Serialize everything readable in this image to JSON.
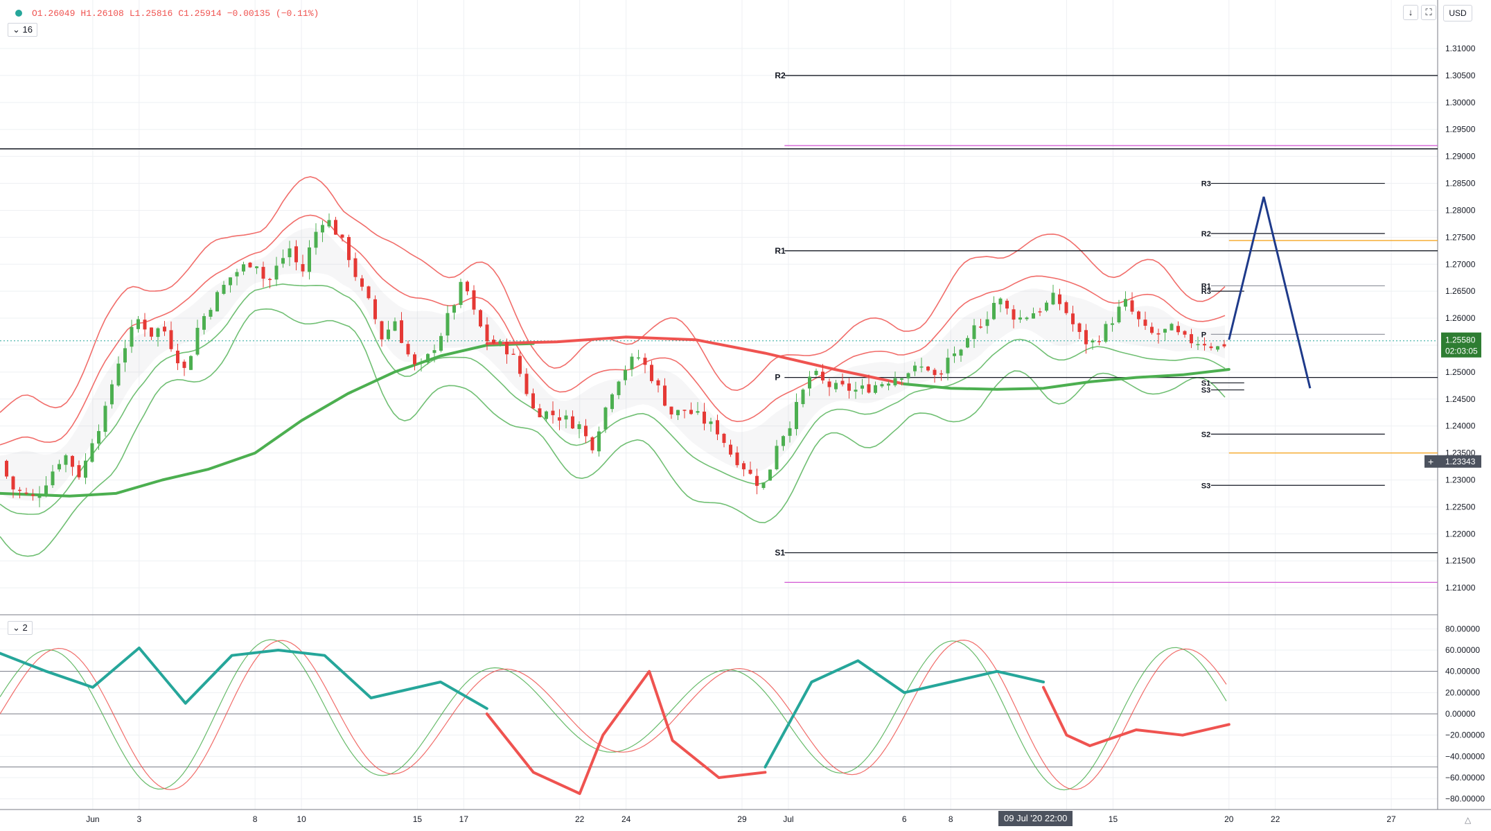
{
  "header": {
    "ohlc": [
      "O1.26049",
      "H1.26108",
      "L1.25816",
      "C1.25914",
      "−0.00135 (−0.11%)"
    ],
    "main_pane_toggle": "16",
    "osc_pane_toggle": "2",
    "currency": "USD",
    "download_icon": "download-icon",
    "fullscreen_icon": "fullscreen-icon",
    "crosshair_time": "09 Jul '20   22:00",
    "last_price_label": "1.25580",
    "countdown_label": "02:03:05",
    "crosshair_price_label": "1.23343"
  },
  "colors": {
    "bull": "#26a69a",
    "bull_candle": "#4caf50",
    "bear": "#ef5350",
    "bear_candle": "#e53935",
    "ma_up": "#4caf50",
    "ma_down": "#ef5350",
    "pivot_line": "#131722",
    "magenta_level": "#d561d6",
    "orange_level": "#f5a623",
    "projection": "#1e3a8a",
    "last_price_bg": "#2e7d32"
  },
  "chart_data": [
    {
      "type": "candlestick",
      "instrument_quote": "USD",
      "y_axis": {
        "range": [
          1.205,
          1.319
        ],
        "ticks": [
          "1.31000",
          "1.30500",
          "1.30000",
          "1.29500",
          "1.29000",
          "1.28500",
          "1.28000",
          "1.27500",
          "1.27000",
          "1.26500",
          "1.26000",
          "1.25500",
          "1.25000",
          "1.24500",
          "1.24000",
          "1.23500",
          "1.23000",
          "1.22500",
          "1.22000",
          "1.21500",
          "1.21000"
        ]
      },
      "x_axis": {
        "range": [
          "2020-05-28",
          "2020-07-29"
        ],
        "ticks": [
          {
            "date": "2020-06-01",
            "label": "Jun"
          },
          {
            "date": "2020-06-03",
            "label": "3"
          },
          {
            "date": "2020-06-08",
            "label": "8"
          },
          {
            "date": "2020-06-10",
            "label": "10"
          },
          {
            "date": "2020-06-15",
            "label": "15"
          },
          {
            "date": "2020-06-17",
            "label": "17"
          },
          {
            "date": "2020-06-22",
            "label": "22"
          },
          {
            "date": "2020-06-24",
            "label": "24"
          },
          {
            "date": "2020-06-29",
            "label": "29"
          },
          {
            "date": "2020-07-01",
            "label": "Jul"
          },
          {
            "date": "2020-07-06",
            "label": "6"
          },
          {
            "date": "2020-07-08",
            "label": "8"
          },
          {
            "date": "2020-07-13",
            "label": "13"
          },
          {
            "date": "2020-07-15",
            "label": "15"
          },
          {
            "date": "2020-07-20",
            "label": "20"
          },
          {
            "date": "2020-07-22",
            "label": "22"
          },
          {
            "date": "2020-07-27",
            "label": "27"
          }
        ]
      },
      "close_path": [
        {
          "x": "2020-05-28",
          "y": 1.2335
        },
        {
          "x": "2020-05-28 12:00",
          "y": 1.2285
        },
        {
          "x": "2020-05-29",
          "y": 1.2275
        },
        {
          "x": "2020-05-29 12:00",
          "y": 1.2265
        },
        {
          "x": "2020-05-30 18:00",
          "y": 1.235
        },
        {
          "x": "2020-05-31 12:00",
          "y": 1.2305
        },
        {
          "x": "2020-06-01",
          "y": 1.238
        },
        {
          "x": "2020-06-01 12:00",
          "y": 1.242
        },
        {
          "x": "2020-06-02",
          "y": 1.251
        },
        {
          "x": "2020-06-02 12:00",
          "y": 1.256
        },
        {
          "x": "2020-06-03",
          "y": 1.26
        },
        {
          "x": "2020-06-03 12:00",
          "y": 1.257
        },
        {
          "x": "2020-06-04",
          "y": 1.2585
        },
        {
          "x": "2020-06-04 12:00",
          "y": 1.254
        },
        {
          "x": "2020-06-05",
          "y": 1.25
        },
        {
          "x": "2020-06-05 12:00",
          "y": 1.258
        },
        {
          "x": "2020-06-06",
          "y": 1.262
        },
        {
          "x": "2020-06-07",
          "y": 1.268
        },
        {
          "x": "2020-06-08",
          "y": 1.271
        },
        {
          "x": "2020-06-08 12:00",
          "y": 1.266
        },
        {
          "x": "2020-06-09",
          "y": 1.27
        },
        {
          "x": "2020-06-09 12:00",
          "y": 1.273
        },
        {
          "x": "2020-06-10",
          "y": 1.268
        },
        {
          "x": "2020-06-10 12:00",
          "y": 1.275
        },
        {
          "x": "2020-06-11",
          "y": 1.279
        },
        {
          "x": "2020-06-11 12:00",
          "y": 1.276
        },
        {
          "x": "2020-06-12",
          "y": 1.272
        },
        {
          "x": "2020-06-12 12:00",
          "y": 1.266
        },
        {
          "x": "2020-06-13",
          "y": 1.262
        },
        {
          "x": "2020-06-13 12:00",
          "y": 1.256
        },
        {
          "x": "2020-06-14",
          "y": 1.26
        },
        {
          "x": "2020-06-14 12:00",
          "y": 1.254
        },
        {
          "x": "2020-06-15",
          "y": 1.25
        },
        {
          "x": "2020-06-15 12:00",
          "y": 1.253
        },
        {
          "x": "2020-06-16",
          "y": 1.257
        },
        {
          "x": "2020-06-16 12:00",
          "y": 1.262
        },
        {
          "x": "2020-06-17",
          "y": 1.267
        },
        {
          "x": "2020-06-17 12:00",
          "y": 1.26
        },
        {
          "x": "2020-06-18",
          "y": 1.256
        },
        {
          "x": "2020-06-18 12:00",
          "y": 1.255
        },
        {
          "x": "2020-06-19",
          "y": 1.254
        },
        {
          "x": "2020-06-19 12:00",
          "y": 1.249
        },
        {
          "x": "2020-06-20",
          "y": 1.243
        },
        {
          "x": "2020-06-21",
          "y": 1.242
        },
        {
          "x": "2020-06-22",
          "y": 1.24
        },
        {
          "x": "2020-06-22 12:00",
          "y": 1.236
        },
        {
          "x": "2020-06-23",
          "y": 1.242
        },
        {
          "x": "2020-06-23 12:00",
          "y": 1.248
        },
        {
          "x": "2020-06-24",
          "y": 1.251
        },
        {
          "x": "2020-06-24 12:00",
          "y": 1.253
        },
        {
          "x": "2020-06-25",
          "y": 1.25
        },
        {
          "x": "2020-06-25 12:00",
          "y": 1.246
        },
        {
          "x": "2020-06-26",
          "y": 1.242
        },
        {
          "x": "2020-06-26 12:00",
          "y": 1.243
        },
        {
          "x": "2020-06-27",
          "y": 1.242
        },
        {
          "x": "2020-06-28",
          "y": 1.239
        },
        {
          "x": "2020-06-28 12:00",
          "y": 1.235
        },
        {
          "x": "2020-06-29",
          "y": 1.233
        },
        {
          "x": "2020-06-29 12:00",
          "y": 1.23
        },
        {
          "x": "2020-06-30",
          "y": 1.229
        },
        {
          "x": "2020-06-30 12:00",
          "y": 1.237
        },
        {
          "x": "2020-07-01",
          "y": 1.24
        },
        {
          "x": "2020-07-01 12:00",
          "y": 1.245
        },
        {
          "x": "2020-07-02",
          "y": 1.25
        },
        {
          "x": "2020-07-02 12:00",
          "y": 1.248
        },
        {
          "x": "2020-07-03",
          "y": 1.247
        },
        {
          "x": "2020-07-03 12:00",
          "y": 1.247
        },
        {
          "x": "2020-07-04",
          "y": 1.2465
        },
        {
          "x": "2020-07-05",
          "y": 1.248
        },
        {
          "x": "2020-07-06",
          "y": 1.25
        },
        {
          "x": "2020-07-06 12:00",
          "y": 1.2505
        },
        {
          "x": "2020-07-07",
          "y": 1.251
        },
        {
          "x": "2020-07-07 12:00",
          "y": 1.248
        },
        {
          "x": "2020-07-08",
          "y": 1.254
        },
        {
          "x": "2020-07-08 12:00",
          "y": 1.253
        },
        {
          "x": "2020-07-09",
          "y": 1.258
        },
        {
          "x": "2020-07-09 12:00",
          "y": 1.26
        },
        {
          "x": "2020-07-10",
          "y": 1.264
        },
        {
          "x": "2020-07-10 12:00",
          "y": 1.261
        },
        {
          "x": "2020-07-11",
          "y": 1.26
        },
        {
          "x": "2020-07-12",
          "y": 1.262
        },
        {
          "x": "2020-07-12 12:00",
          "y": 1.264
        },
        {
          "x": "2020-07-13",
          "y": 1.261
        },
        {
          "x": "2020-07-13 12:00",
          "y": 1.257
        },
        {
          "x": "2020-07-14",
          "y": 1.255
        },
        {
          "x": "2020-07-14 12:00",
          "y": 1.257
        },
        {
          "x": "2020-07-15",
          "y": 1.26
        },
        {
          "x": "2020-07-15 12:00",
          "y": 1.263
        },
        {
          "x": "2020-07-16",
          "y": 1.26
        },
        {
          "x": "2020-07-16 12:00",
          "y": 1.257
        },
        {
          "x": "2020-07-17",
          "y": 1.257
        },
        {
          "x": "2020-07-17 12:00",
          "y": 1.258
        },
        {
          "x": "2020-07-18",
          "y": 1.256
        },
        {
          "x": "2020-07-19",
          "y": 1.2555
        },
        {
          "x": "2020-07-19 12:00",
          "y": 1.2545
        },
        {
          "x": "2020-07-20",
          "y": 1.2558
        }
      ],
      "moving_averages": [
        {
          "color": "ma_up",
          "points": [
            {
              "x": "2020-05-28",
              "y": 1.2275
            },
            {
              "x": "2020-05-31",
              "y": 1.227
            },
            {
              "x": "2020-06-02",
              "y": 1.2275
            },
            {
              "x": "2020-06-04",
              "y": 1.23
            },
            {
              "x": "2020-06-06",
              "y": 1.232
            },
            {
              "x": "2020-06-08",
              "y": 1.235
            },
            {
              "x": "2020-06-10",
              "y": 1.241
            },
            {
              "x": "2020-06-12",
              "y": 1.246
            },
            {
              "x": "2020-06-14",
              "y": 1.25
            },
            {
              "x": "2020-06-16",
              "y": 1.253
            },
            {
              "x": "2020-06-18",
              "y": 1.255
            },
            {
              "x": "2020-06-20",
              "y": 1.2553
            }
          ]
        },
        {
          "color": "ma_down",
          "points": [
            {
              "x": "2020-06-18",
              "y": 1.2553
            },
            {
              "x": "2020-06-21",
              "y": 1.2556
            },
            {
              "x": "2020-06-24",
              "y": 1.2565
            },
            {
              "x": "2020-06-27",
              "y": 1.256
            },
            {
              "x": "2020-06-30",
              "y": 1.2535
            },
            {
              "x": "2020-07-03",
              "y": 1.2505
            },
            {
              "x": "2020-07-06",
              "y": 1.2478
            }
          ]
        },
        {
          "color": "ma_up",
          "points": [
            {
              "x": "2020-07-06",
              "y": 1.2478
            },
            {
              "x": "2020-07-08",
              "y": 1.247
            },
            {
              "x": "2020-07-10",
              "y": 1.2468
            },
            {
              "x": "2020-07-12",
              "y": 1.247
            },
            {
              "x": "2020-07-14",
              "y": 1.2482
            },
            {
              "x": "2020-07-16",
              "y": 1.249
            },
            {
              "x": "2020-07-18",
              "y": 1.2495
            },
            {
              "x": "2020-07-20",
              "y": 1.2505
            }
          ]
        }
      ],
      "pivot_levels_june": [
        {
          "label": "R2",
          "value": 1.305
        },
        {
          "label": "R1",
          "value": 1.2725
        },
        {
          "label": "P",
          "value": 1.249
        },
        {
          "label": "S1",
          "value": 1.2165
        }
      ],
      "pivot_levels_week": [
        {
          "label": "R3",
          "value": 1.285
        },
        {
          "label": "R2",
          "value": 1.2757
        },
        {
          "label": "R1",
          "value": 1.266
        },
        {
          "label": "R3",
          "value": 1.265
        },
        {
          "label": "P",
          "value": 1.257
        },
        {
          "label": "S1",
          "value": 1.248
        },
        {
          "label": "S3",
          "value": 1.2467
        },
        {
          "label": "S2",
          "value": 1.2385
        },
        {
          "label": "S3",
          "value": 1.229
        }
      ],
      "horizontal_levels": [
        {
          "value": 1.2914,
          "color": "pivot_line"
        },
        {
          "value": 1.292,
          "color": "magenta_level"
        },
        {
          "value": 1.211,
          "color": "magenta_level"
        },
        {
          "value": 1.2744,
          "color": "orange_level"
        },
        {
          "value": 1.235,
          "color": "orange_level"
        },
        {
          "value": 1.2558,
          "color": "bull"
        }
      ],
      "projection": [
        {
          "x": "2020-07-20",
          "y": 1.256
        },
        {
          "x": "2020-07-21 12:00",
          "y": 1.2825
        },
        {
          "x": "2020-07-23 12:00",
          "y": 1.247
        }
      ]
    },
    {
      "type": "line",
      "y_axis": {
        "range": [
          -90,
          90
        ],
        "ticks": [
          "80.00000",
          "60.00000",
          "40.00000",
          "20.00000",
          "0.00000",
          "−20.00000",
          "−40.00000",
          "−60.00000",
          "−80.00000"
        ],
        "ref_lines": [
          40,
          0,
          -50
        ]
      },
      "series": [
        {
          "color": "bull",
          "points": [
            {
              "x": "2020-05-28",
              "y": 57
            },
            {
              "x": "2020-05-30",
              "y": 40
            },
            {
              "x": "2020-06-01",
              "y": 25
            },
            {
              "x": "2020-06-03",
              "y": 62
            },
            {
              "x": "2020-06-05",
              "y": 10
            },
            {
              "x": "2020-06-07",
              "y": 55
            },
            {
              "x": "2020-06-09",
              "y": 60
            },
            {
              "x": "2020-06-11",
              "y": 55
            },
            {
              "x": "2020-06-13",
              "y": 15
            },
            {
              "x": "2020-06-16",
              "y": 30
            },
            {
              "x": "2020-06-18",
              "y": 5
            }
          ]
        },
        {
          "color": "bear",
          "points": [
            {
              "x": "2020-06-18",
              "y": 0
            },
            {
              "x": "2020-06-20",
              "y": -55
            },
            {
              "x": "2020-06-22",
              "y": -75
            },
            {
              "x": "2020-06-23",
              "y": -20
            },
            {
              "x": "2020-06-25",
              "y": 40
            },
            {
              "x": "2020-06-26",
              "y": -25
            },
            {
              "x": "2020-06-28",
              "y": -60
            },
            {
              "x": "2020-06-30",
              "y": -55
            }
          ]
        },
        {
          "color": "bull",
          "points": [
            {
              "x": "2020-06-30",
              "y": -50
            },
            {
              "x": "2020-07-02",
              "y": 30
            },
            {
              "x": "2020-07-04",
              "y": 50
            },
            {
              "x": "2020-07-06",
              "y": 20
            },
            {
              "x": "2020-07-08",
              "y": 30
            },
            {
              "x": "2020-07-10",
              "y": 40
            },
            {
              "x": "2020-07-12",
              "y": 30
            }
          ]
        },
        {
          "color": "bear",
          "points": [
            {
              "x": "2020-07-12",
              "y": 25
            },
            {
              "x": "2020-07-13",
              "y": -20
            },
            {
              "x": "2020-07-14",
              "y": -30
            },
            {
              "x": "2020-07-16",
              "y": -15
            },
            {
              "x": "2020-07-18",
              "y": -20
            },
            {
              "x": "2020-07-20",
              "y": -10
            }
          ]
        }
      ]
    }
  ]
}
